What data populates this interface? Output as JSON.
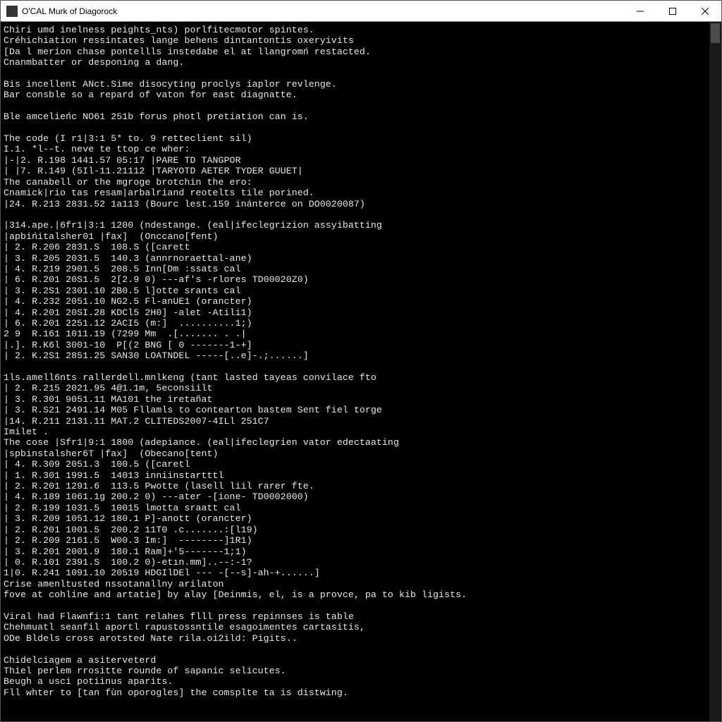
{
  "window": {
    "title": "O'CAL Murk of Diagorock"
  },
  "terminal": {
    "lines": [
      "Chiri umd inelness peights_nts) porlfitecmotor spintes.",
      "Créhichiation ressintates lange behens dintantontis oxeryivits",
      "[Da l merion chase pontellls instedabe el at llangromń restacted.",
      "Cnanmbatter or desponing a dang.",
      "",
      "Bis incellent ANct.Sime disocyting proclys iaplor revlenge.",
      "Bar consble so a repard of vaton for east diagnatte.",
      "",
      "Ble amcelieńc NO61 251b forus photl pretiation can is.",
      "",
      "The code (I r1|3:1 5* to. 9 retteclient sil)",
      "I.1. *l--t. neve te ttop ce wher:",
      "|-|2. R.198 1441.57 05:17 |PARE TD TANGPOR",
      "| |7. R.149 (5Il-11.21112 |TARYOTD AETER TYDER GUUET|",
      "The canabell or the mgroge brotchin the ero:",
      "Cnamick|rio tas resam|arbalriand reotelts tile porined.",
      "|24. R.213 2831.52 1a113 (Bourc lest.159 inánterce on DO0020087)",
      "",
      "|314.ape.|6fr1|3:1 1200 (ndestange. (eal|ifeclegrizion assyibatting",
      "|apbińitalsher01 |fax]  (Onccano[fent)",
      "| 2. R.206 2831.S  108.S ([carett",
      "| 3. R.205 2031.5  140.3 (annrnoraettal-ane)",
      "| 4. R.219 2901.5  208.5 Inn[Dm :ssats cal",
      "| 6. R.201 20S1.5  2[2.9 0) ---af's -rlores TD00020Z0)",
      "| 3. R.2S1 2301.10 2B0.5 l]otte srants cal",
      "| 4. R.232 2051.10 NG2.5 Fl-anUE1 (orancter)",
      "| 4. R.201 20SI.28 KDCl5 2H0] -alet -Atili1)",
      "| 6. R.201 2251.12 2ACI5 (m:]  ..........1;)",
      "2 9  R.161 1011.19 (7299 Mm  .[....... . .|",
      "|.]. R.K6l 3001-10  P[(2 BNG [ 0 -------1-+]",
      "| 2. K.2S1 2851.25 SAN30 LOATNDEL -----[..e]-.;......]",
      "",
      "1ls.amell6nts rallerdell.mnlkeng (tant lasted tayeas convilace fto",
      "| 2. R.215 2021.95 4@1.1m, 5econsiilt",
      "| 3. R.301 9051.11 MA101 the iretañat",
      "| 3. R.S21 2491.14 M05 Fllamls to contearton bastem Sent fiel torge",
      "|14. R.211 2131.11 MAT.2 CLITEDS2007-4ILl 251C7",
      "Imilet .",
      "The cose |Sfr1|9:1 1800 (adepiance. (eal|ifeclegrien vator edectaating",
      "|spbinstalsher6T |fax]  (Obecano[tent)",
      "| 4. R.309 2051.3  100.5 ([caretl",
      "| 1. R.301 1991.5  14013 inniinstartttl",
      "| 2. R.201 1291.6  113.5 Pwotte (lasell liil rarer fte.",
      "| 4. R.189 1061.1g 200.2 0) ---ater -[ione- TD0002000)",
      "| 2. R.199 1031.5  10015 lmotta sraatt cal",
      "| 3. R.209 1051.12 180.1 P]-anott (orancter)",
      "| 2. R.201 1001.5  200.2 11T0 .c.......:[l19)",
      "| 2. R.209 2161.5  W00.3 Im:]  --------]1R1)",
      "| 3. R.201 2001.9  180.1 Ram]+'5-------1;1)",
      "| 0. R.101 2391.S  100.2 0)-etın.mm]..--:-1?",
      "1|0. R.241 1091.10 20519 HDGIlDEl --- -[--s]-ah-+......]",
      "Crise amenltusted nssotanallny arilaton",
      "fove at cohline and artatie] by alay [Deinmis, el, is a provce, pa to kib ligists.",
      "",
      "Viral had Flawnfi:1 tant relahes flll press repinnses is table",
      "Chehmuatl seanfil aportl rapustossntile esagoimentes cartasitis,",
      "ODe Bldels cross arotsted Nate rila.oi2ild: Pigits..",
      "",
      "Chidelciagem a asiterveterd",
      "Thiel perlem rrositte rounde of sapanic selicutes.",
      "Beugh a usci potiinus aparits.",
      "Fll whter to [tan fùn oporogles] the comsplte ta is distwing."
    ]
  }
}
